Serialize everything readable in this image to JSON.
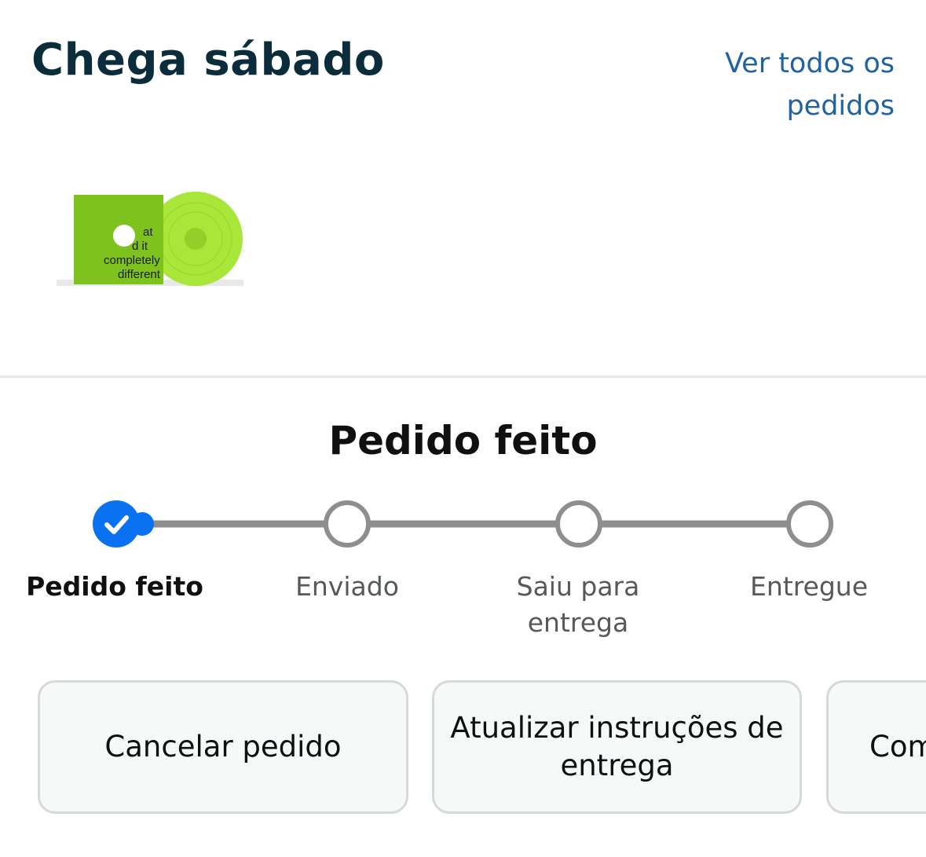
{
  "header": {
    "title": "Chega sábado",
    "view_all_link": "Ver todos os pedidos"
  },
  "product": {
    "image_icon": "vinyl-record-thumbnail",
    "cover_text": "at d it completely different",
    "colors": {
      "cover": "#7ec31d",
      "disc": "#a8e63a"
    }
  },
  "status": {
    "heading": "Pedido feito",
    "steps": [
      {
        "label": "Pedido feito",
        "state": "complete"
      },
      {
        "label": "Enviado",
        "state": "pending"
      },
      {
        "label": "Saiu para entrega",
        "state": "pending"
      },
      {
        "label": "Entregue",
        "state": "pending"
      }
    ],
    "colors": {
      "active": "#0a72f0",
      "track": "#8e8e8e"
    }
  },
  "actions": [
    {
      "label": "Cancelar pedido"
    },
    {
      "label": "Atualizar instruções de entrega"
    },
    {
      "label": "Com"
    }
  ]
}
